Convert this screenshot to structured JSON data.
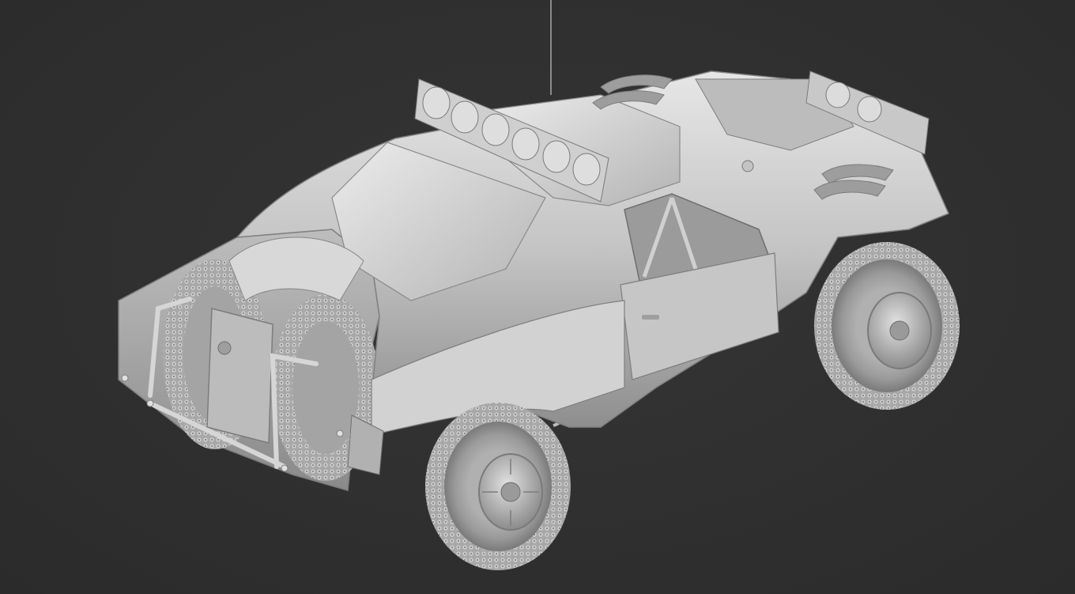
{
  "viewport": {
    "background": "#303030",
    "model_color": "#c9c9c9",
    "model_shadow": "#7a7a7a",
    "model_highlight": "#eeeeee"
  },
  "model": {
    "icon": "trophy-truck-model-icon"
  }
}
